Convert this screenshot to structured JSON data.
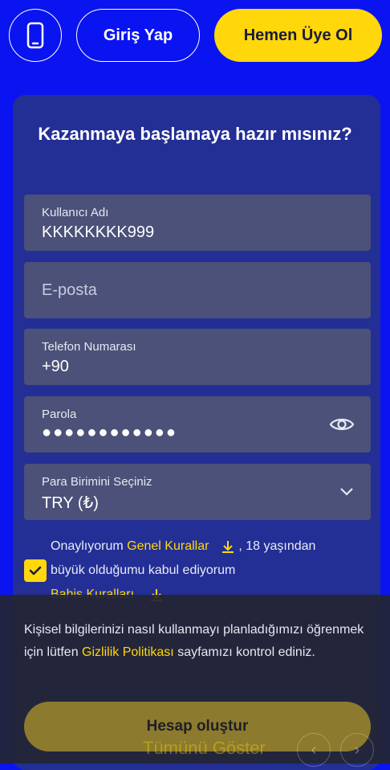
{
  "header": {
    "phone_icon": "smartphone-icon",
    "login_label": "Giriş Yap",
    "signup_label": "Hemen Üye Ol"
  },
  "form": {
    "title": "Kazanmaya başlamaya hazır mısınız?",
    "username": {
      "label": "Kullanıcı Adı",
      "value": "KKKKKKKK999"
    },
    "email": {
      "placeholder": "E-posta"
    },
    "phone": {
      "label": "Telefon Numarası",
      "value": "+90"
    },
    "password": {
      "label": "Parola",
      "value": "●●●●●●●●●●●●",
      "toggle_icon": "eye-icon"
    },
    "currency": {
      "label": "Para Birimini Seçiniz",
      "value": "TRY (₺)",
      "icon": "chevron-down-icon"
    },
    "terms": {
      "prefix": "Onaylıyorum",
      "general_rules": "Genel Kurallar",
      "age_text": ", 18 yaşından",
      "line2": "büyük olduğumu kabul ediyorum",
      "betting_rules": "Bahis Kuralları",
      "checked": true
    }
  },
  "cookie": {
    "text_before": "Kişisel bilgilerinizi nasıl kullanmayı planladığımızı öğrenmek için lütfen",
    "privacy_link": "Gizlilik Politikası",
    "text_after": "sayfamızı kontrol ediniz."
  },
  "create_button_label": "Hesap oluştur",
  "show_all_label": "Tümünü Göster",
  "colors": {
    "background": "#0a14f0",
    "card": "#232f95",
    "field": "#4b5178",
    "accent": "#ffd70a"
  }
}
